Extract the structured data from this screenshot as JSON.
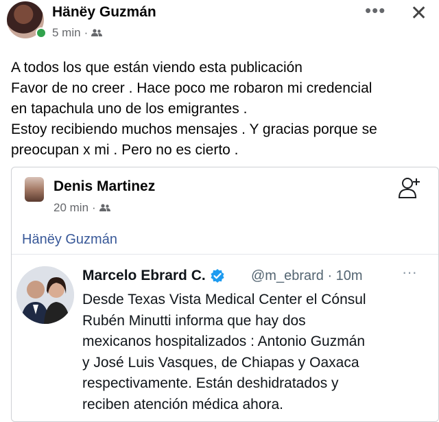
{
  "post": {
    "author": "Hänëy Guzmán",
    "time": "5 min",
    "more_label": "•••",
    "close_label": "✕",
    "lines": [
      "A todos los que están viendo esta publicación",
      "Favor de no creer . Hace poco me robaron mi credencial",
      "en tapachula uno de los emigrantes .",
      "Estoy recibiendo muchos mensajes . Y gracias porque se",
      "preocupan x mi . Pero no es cierto ."
    ]
  },
  "shared": {
    "author": "Denis Martinez",
    "time": "20 min",
    "tag": "Hänëy Guzmán"
  },
  "tweet": {
    "name": "Marcelo Ebrard C.",
    "handle_time": "@m_ebrard · 10m",
    "more_label": "···",
    "lines": [
      "Desde Texas Vista Medical Center el Cónsul",
      "Rubén Minutti informa que hay dos",
      "mexicanos hospitalizados : Antonio Guzmán",
      "y José Luis Vasques, de Chiapas y Oaxaca",
      "respectivamente. Están deshidratados y",
      "reciben atención médica ahora."
    ]
  },
  "icons": {
    "audience": "friends-icon",
    "verified": "verified-badge-icon",
    "add_friend": "add-friend-icon"
  },
  "colors": {
    "link": "#385898",
    "online": "#31a24c",
    "verified": "#1d9bf0"
  }
}
